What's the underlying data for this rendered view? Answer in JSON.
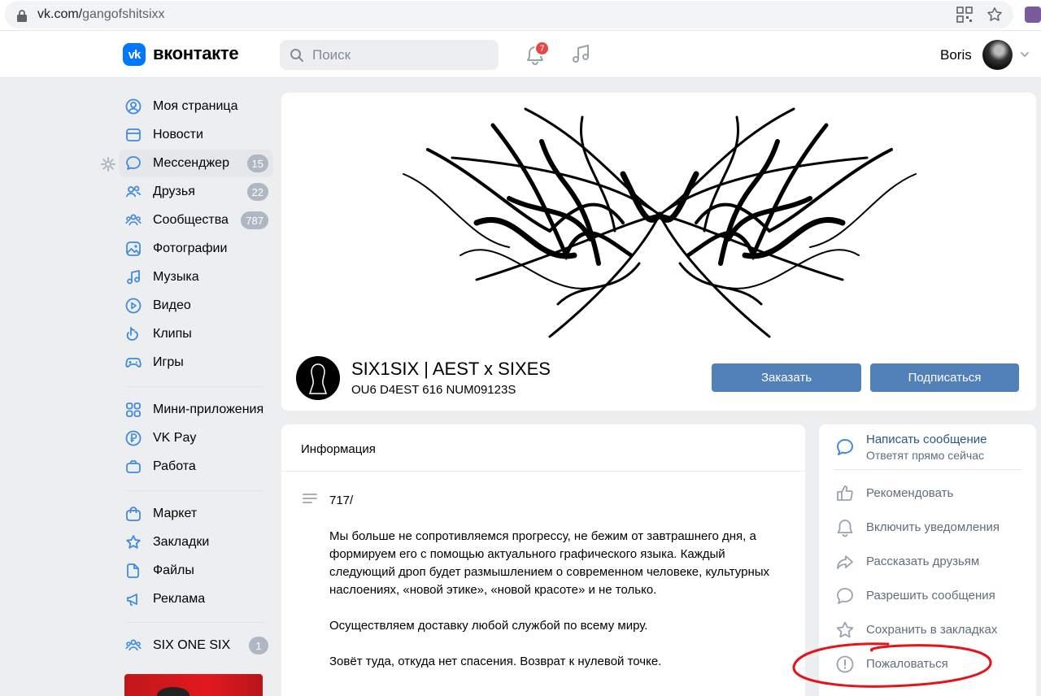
{
  "browser": {
    "url_domain": "vk.com/",
    "url_path": "gangofshitsixx"
  },
  "header": {
    "logo_mark": "vk",
    "logo_text": "вконтакте",
    "search_placeholder": "Поиск",
    "notifications_count": "7",
    "user_name": "Boris"
  },
  "sidebar": {
    "items": [
      {
        "label": "Моя страница",
        "icon": "user-circle-icon"
      },
      {
        "label": "Новости",
        "icon": "news-icon"
      },
      {
        "label": "Мессенджер",
        "icon": "chat-icon",
        "count": "15"
      },
      {
        "label": "Друзья",
        "icon": "friends-icon",
        "count": "22"
      },
      {
        "label": "Сообщества",
        "icon": "communities-icon",
        "count": "787"
      },
      {
        "label": "Фотографии",
        "icon": "photo-icon"
      },
      {
        "label": "Музыка",
        "icon": "music-icon"
      },
      {
        "label": "Видео",
        "icon": "video-icon"
      },
      {
        "label": "Клипы",
        "icon": "clips-icon"
      },
      {
        "label": "Игры",
        "icon": "gamepad-icon"
      },
      {
        "label": "Мини-приложения",
        "icon": "apps-icon"
      },
      {
        "label": "VK Pay",
        "icon": "ruble-icon"
      },
      {
        "label": "Работа",
        "icon": "briefcase-icon"
      },
      {
        "label": "Маркет",
        "icon": "market-bag-icon"
      },
      {
        "label": "Закладки",
        "icon": "star-icon"
      },
      {
        "label": "Файлы",
        "icon": "file-icon"
      },
      {
        "label": "Реклама",
        "icon": "megaphone-icon"
      },
      {
        "label": "SIX ONE SIX",
        "icon": "communities-icon",
        "count": "1"
      }
    ]
  },
  "group": {
    "name": "SIX1SIX | AEST x SIXES",
    "status": "OU6 D4EST 616 NUM09123S",
    "order_button": "Заказать",
    "subscribe_button": "Подписаться"
  },
  "info": {
    "title": "Информация",
    "paragraphs": [
      "717/",
      "Мы больше не сопротивляемся прогрессу, не бежим от завтрашнего дня, а формируем его с помощью актуального графического языка. Каждый следующий дроп будет размышлением о современном человеке, культурных наслоениях, «новой этике», «новой красоте» и не только.",
      "Осуществляем доставку любой службой по всему миру.",
      "Зовёт туда, откуда нет спасения. Возврат к нулевой точке."
    ]
  },
  "actions": {
    "message_title": "Написать сообщение",
    "message_sub": "Ответят прямо сейчас",
    "items": [
      {
        "label": "Рекомендовать",
        "icon": "thumbs-up-icon"
      },
      {
        "label": "Включить уведомления",
        "icon": "bell-icon"
      },
      {
        "label": "Рассказать друзьям",
        "icon": "share-icon"
      },
      {
        "label": "Разрешить сообщения",
        "icon": "chat-icon"
      },
      {
        "label": "Сохранить в закладках",
        "icon": "star-icon"
      },
      {
        "label": "Пожаловаться",
        "icon": "report-icon"
      }
    ]
  },
  "colors": {
    "accent": "#0077ff",
    "button": "#5181b8",
    "badge_red": "#e64646",
    "annotation_red": "#e5131a"
  }
}
